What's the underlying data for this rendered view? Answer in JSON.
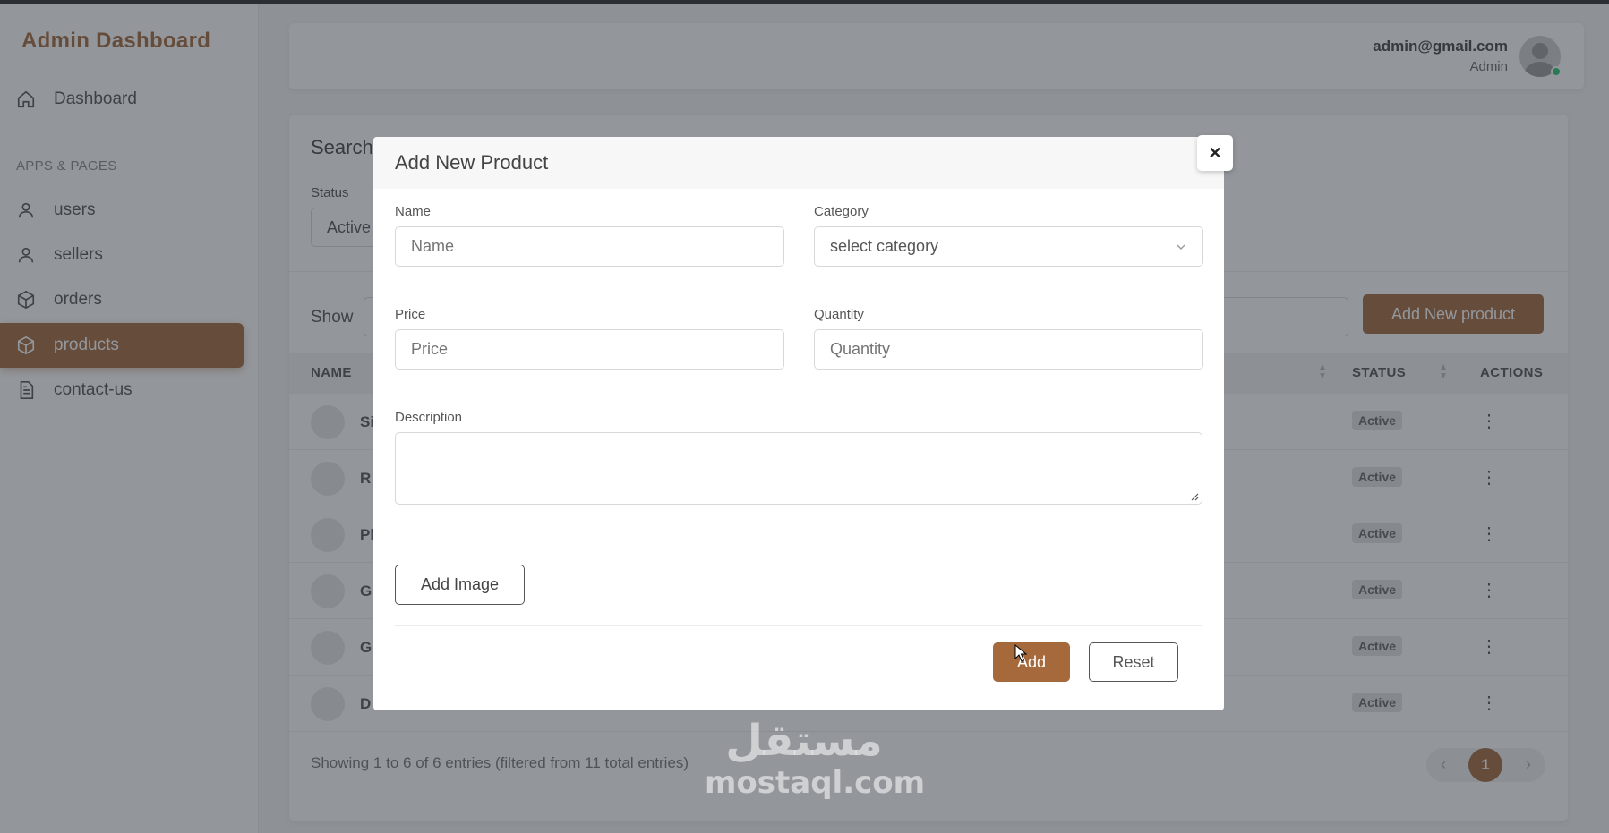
{
  "app": {
    "title": "Admin Dashboard"
  },
  "colors": {
    "accent": "#a5693b",
    "status_online": "#28c76f"
  },
  "sidebar": {
    "dashboard": {
      "label": "Dashboard",
      "icon": "home-icon"
    },
    "section_title": "APPS & PAGES",
    "items": [
      {
        "label": "users",
        "icon": "user-icon"
      },
      {
        "label": "sellers",
        "icon": "user-icon"
      },
      {
        "label": "orders",
        "icon": "box-icon"
      },
      {
        "label": "products",
        "icon": "box-icon",
        "active": true
      },
      {
        "label": "contact-us",
        "icon": "document-icon"
      }
    ]
  },
  "header": {
    "user_email": "admin@gmail.com",
    "user_role": "Admin"
  },
  "filters": {
    "title": "Search",
    "status_label": "Status",
    "status_value": "Active"
  },
  "table": {
    "show_label": "Show",
    "add_button_label": "Add New product",
    "columns": {
      "name": "NAME",
      "status": "STATUS",
      "actions": "ACTIONS"
    },
    "rows": [
      {
        "name_fragment": "Si",
        "status": "Active"
      },
      {
        "name_fragment": "R",
        "status": "Active"
      },
      {
        "name_fragment": "Pl",
        "status": "Active"
      },
      {
        "name_fragment": "G",
        "status": "Active"
      },
      {
        "name_fragment": "G",
        "status": "Active"
      },
      {
        "name_fragment": "D",
        "status": "Active"
      }
    ],
    "entries_info": "Showing 1 to 6 of 6 entries (filtered from 11 total entries)",
    "pagination": {
      "current_page": "1",
      "prev": "‹",
      "next": "›"
    }
  },
  "modal": {
    "title": "Add New Product",
    "close_symbol": "✕",
    "fields": {
      "name": {
        "label": "Name",
        "placeholder": "Name"
      },
      "category": {
        "label": "Category",
        "value": "select category"
      },
      "price": {
        "label": "Price",
        "placeholder": "Price"
      },
      "quantity": {
        "label": "Quantity",
        "placeholder": "Quantity"
      },
      "description": {
        "label": "Description"
      }
    },
    "add_image_label": "Add Image",
    "add_label": "Add",
    "reset_label": "Reset"
  },
  "watermark": {
    "logo": "مستقل",
    "text": "mostaql.com"
  }
}
